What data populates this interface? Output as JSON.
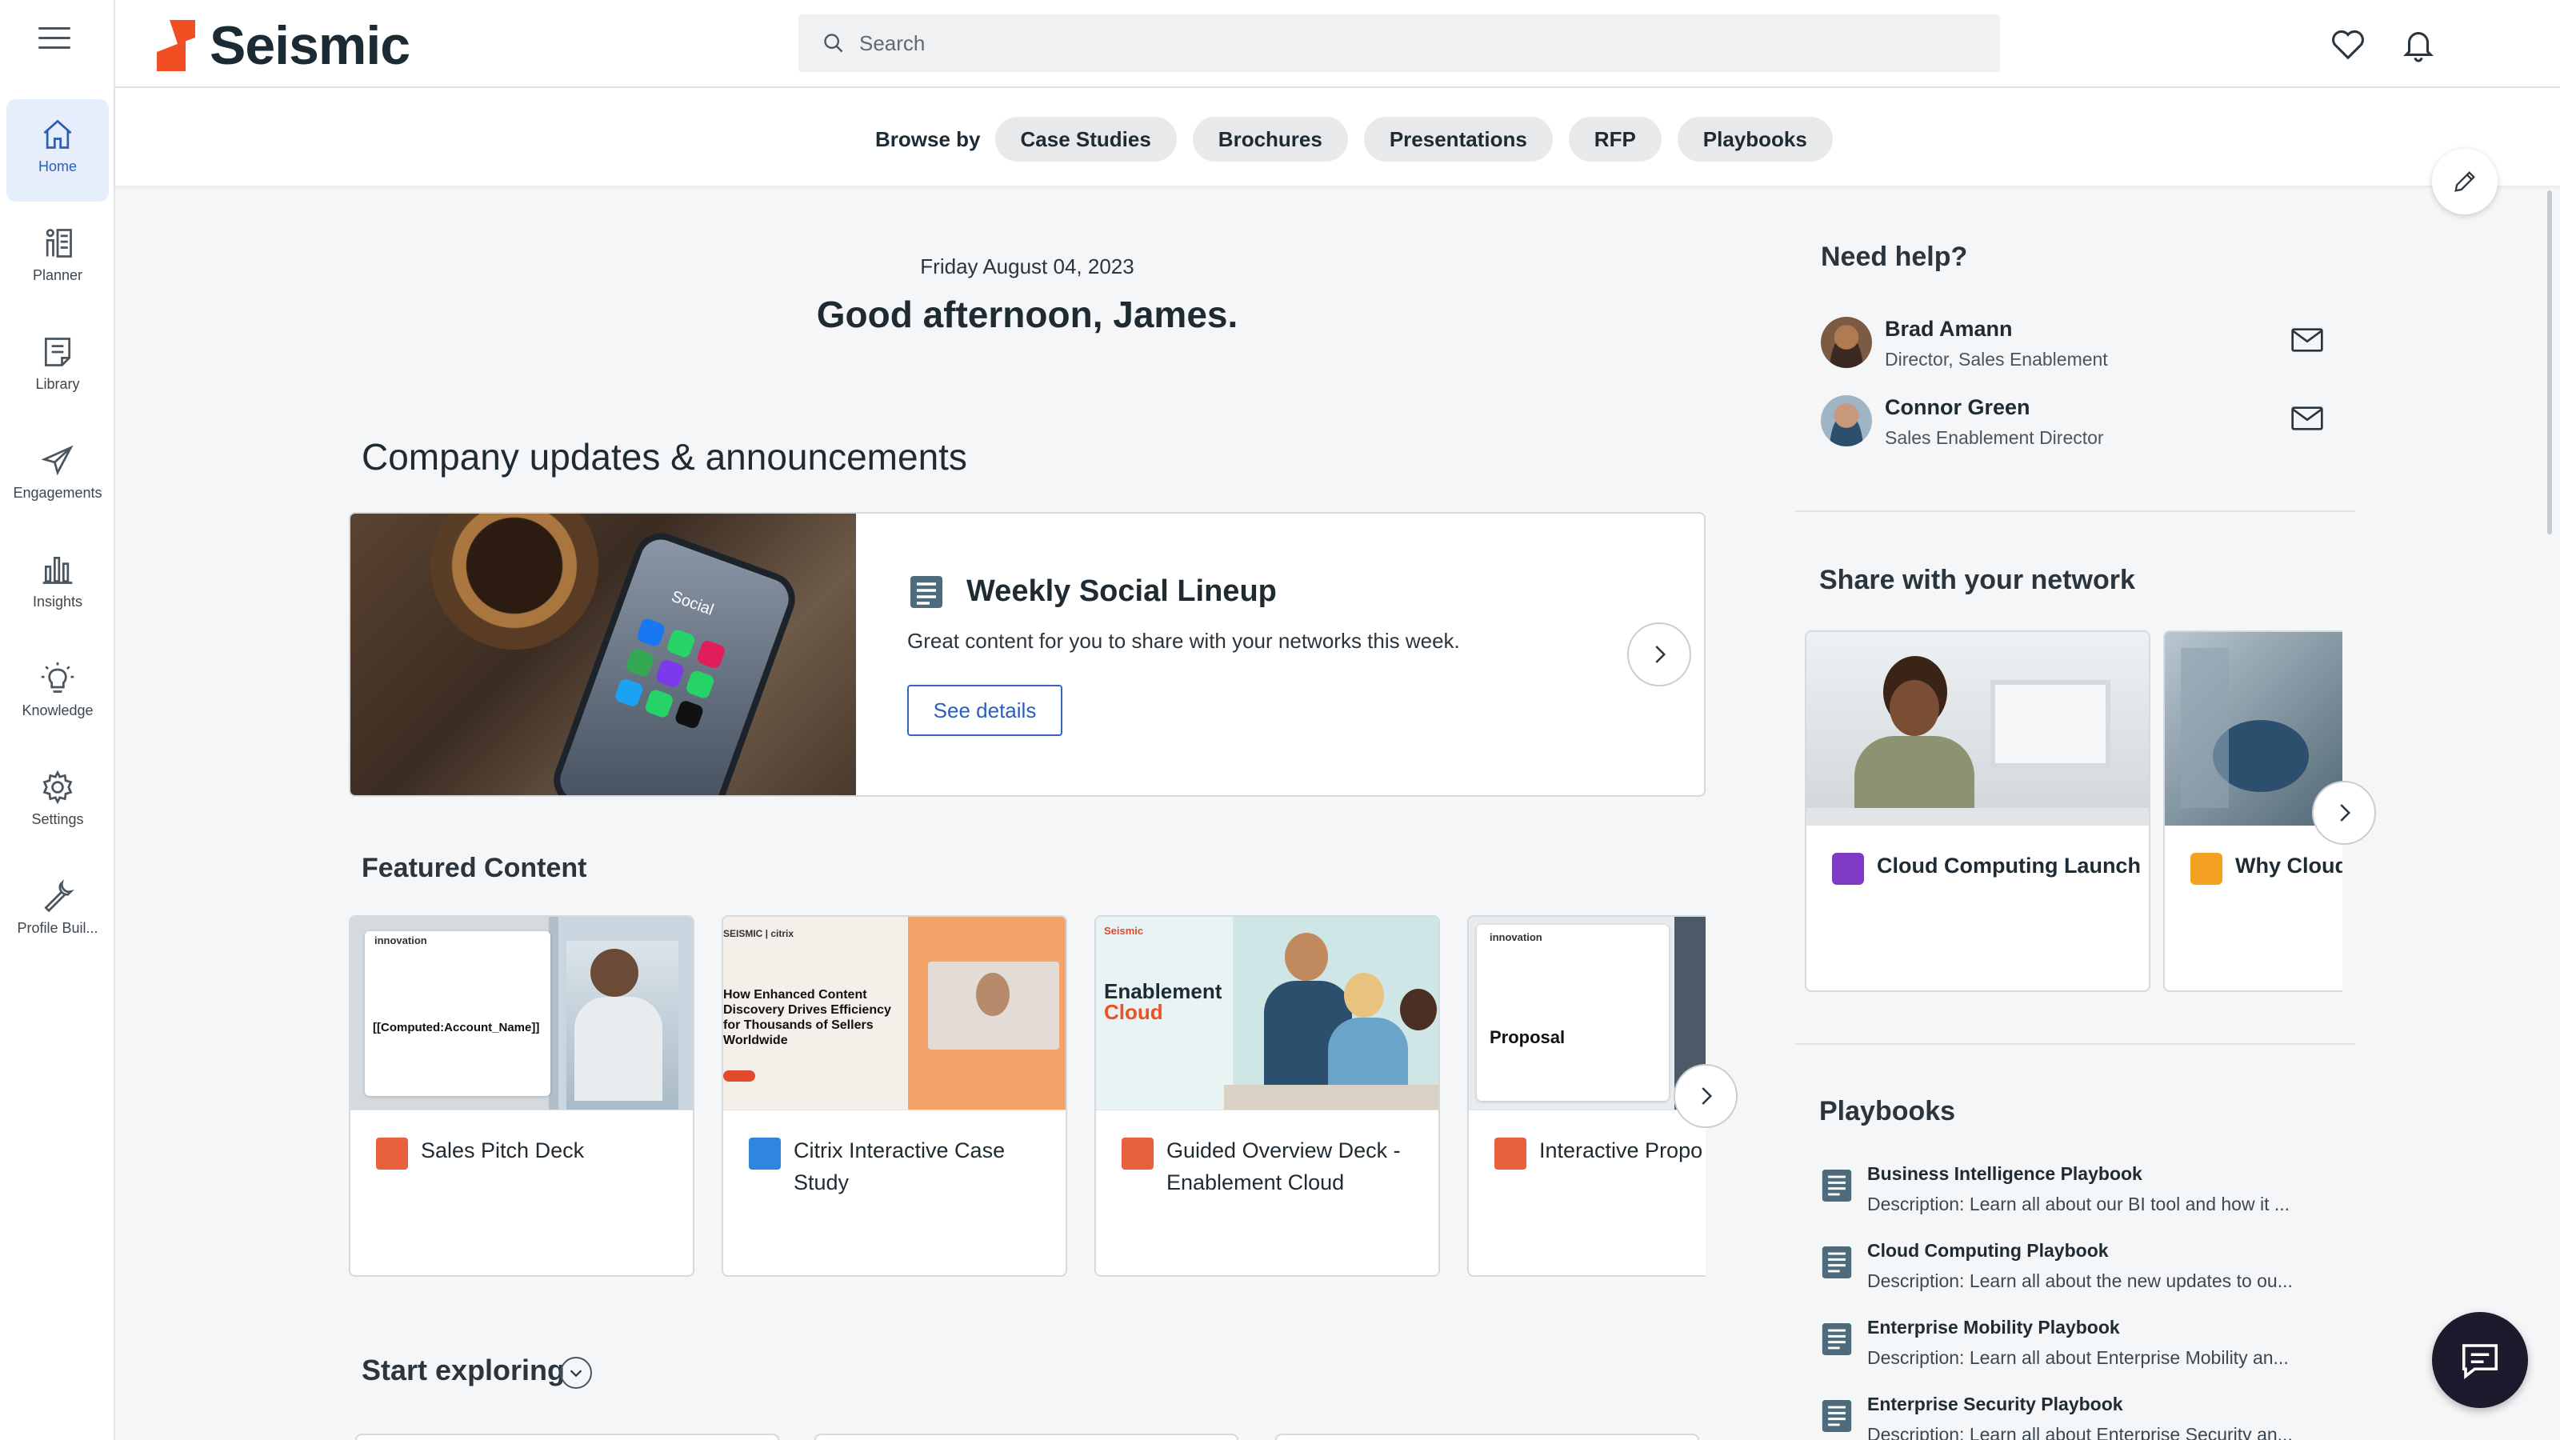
{
  "nav": {
    "items": [
      {
        "label": "Home",
        "icon": "home-icon"
      },
      {
        "label": "Planner",
        "icon": "planner-icon"
      },
      {
        "label": "Library",
        "icon": "library-icon"
      },
      {
        "label": "Engagements",
        "icon": "paper-plane-icon"
      },
      {
        "label": "Insights",
        "icon": "bar-chart-icon"
      },
      {
        "label": "Knowledge",
        "icon": "lightbulb-icon"
      },
      {
        "label": "Settings",
        "icon": "gear-icon"
      },
      {
        "label": "Profile Buil...",
        "icon": "wrench-icon"
      }
    ]
  },
  "header": {
    "logo_text": "Seismic",
    "search_placeholder": "Search"
  },
  "browse": {
    "label": "Browse by",
    "chips": [
      "Case Studies",
      "Brochures",
      "Presentations",
      "RFP",
      "Playbooks"
    ]
  },
  "main": {
    "date": "Friday August 04, 2023",
    "greeting": "Good afternoon, James.",
    "updates_title": "Company updates & announcements",
    "announcement": {
      "title": "Weekly Social Lineup",
      "description": "Great content for you to share with your networks this week.",
      "button": "See details",
      "image_text": "Social"
    },
    "featured_title": "Featured Content",
    "featured": [
      {
        "title": "Sales Pitch Deck",
        "thumb_text": "[[Computed:Account_Name]]",
        "brand": "innovation"
      },
      {
        "title": "Citrix Interactive Case Study",
        "thumb_text": "How Enhanced Content Discovery Drives Efficiency for Thousands of Sellers Worldwide",
        "brand": "SEISMIC | citrix"
      },
      {
        "title": "Guided Overview Deck - Enablement Cloud",
        "thumb_text": "Enablement",
        "thumb_text2": "Cloud",
        "brand": "Seismic"
      },
      {
        "title": "Interactive Propo",
        "thumb_text": "Proposal",
        "brand": "innovation"
      }
    ],
    "explore_title": "Start exploring"
  },
  "right": {
    "help_title": "Need help?",
    "people": [
      {
        "name": "Brad Amann",
        "role": "Director, Sales Enablement"
      },
      {
        "name": "Connor Green",
        "role": "Sales Enablement Director"
      }
    ],
    "share_title": "Share with your network",
    "share": [
      {
        "title": "Cloud Computing Launch"
      },
      {
        "title": "Why Cloud Essential Te"
      }
    ],
    "playbooks_title": "Playbooks",
    "playbooks": [
      {
        "title": "Business Intelligence Playbook",
        "desc": "Description: Learn all about our BI tool and how it ..."
      },
      {
        "title": "Cloud Computing Playbook",
        "desc": "Description: Learn all about the new updates to ou..."
      },
      {
        "title": "Enterprise Mobility Playbook",
        "desc": "Description: Learn all about Enterprise Mobility an..."
      },
      {
        "title": "Enterprise Security Playbook",
        "desc": "Description: Learn all about Enterprise Security an..."
      }
    ]
  },
  "colors": {
    "accent": "#2c5fb5",
    "brand": "#f04e23",
    "nav_active_bg": "#e6eefb",
    "chat_fab": "#1d1a2e"
  }
}
